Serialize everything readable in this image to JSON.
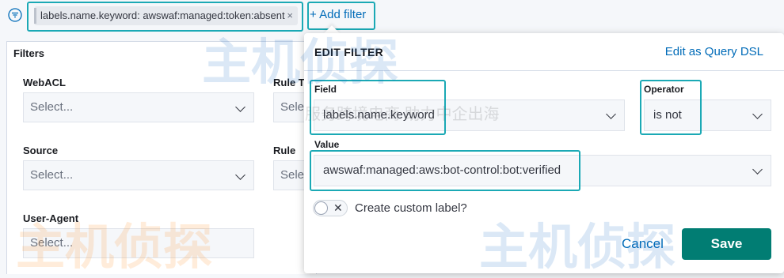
{
  "toolbar": {
    "filter_pill": "labels.name.keyword: awswaf:managed:token:absent",
    "pill_close": "×",
    "add_filter": "+ Add filter"
  },
  "filters": {
    "title": "Filters",
    "fields": [
      {
        "label": "WebACL",
        "placeholder": "Select..."
      },
      {
        "label": "Rule Ty",
        "placeholder": "Sele"
      },
      {
        "label": "Source",
        "placeholder": "Select..."
      },
      {
        "label": "Rule",
        "placeholder": "Sele"
      },
      {
        "label": "User-Agent",
        "placeholder": "Select..."
      }
    ]
  },
  "edit_filter": {
    "title": "EDIT FILTER",
    "edit_dsl": "Edit as Query DSL",
    "field_label": "Field",
    "field_value": "labels.name.keyword",
    "operator_label": "Operator",
    "operator_value": "is not",
    "value_label": "Value",
    "value": "awswaf:managed:aws:bot-control:bot:verified",
    "toggle_x": "✕",
    "custom_label": "Create custom label?",
    "cancel": "Cancel",
    "save": "Save"
  },
  "watermark": {
    "text": "主机侦探",
    "subtitle": "服务跨境电商 助力中企出海"
  },
  "colors": {
    "accent_outline": "#1ba9b5",
    "link": "#006bb8",
    "save_button": "#017d73"
  }
}
